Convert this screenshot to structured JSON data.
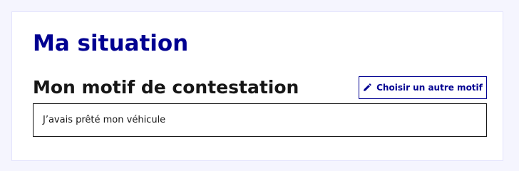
{
  "page": {
    "title": "Ma situation"
  },
  "section": {
    "title": "Mon motif de contestation",
    "choose_button_label": "Choisir un autre motif",
    "choose_button_icon": "pencil-icon",
    "motif_text": "J’avais prêté mon véhicule"
  },
  "colors": {
    "accent": "#000091",
    "text": "#161616",
    "background": "#f5f5fe"
  }
}
